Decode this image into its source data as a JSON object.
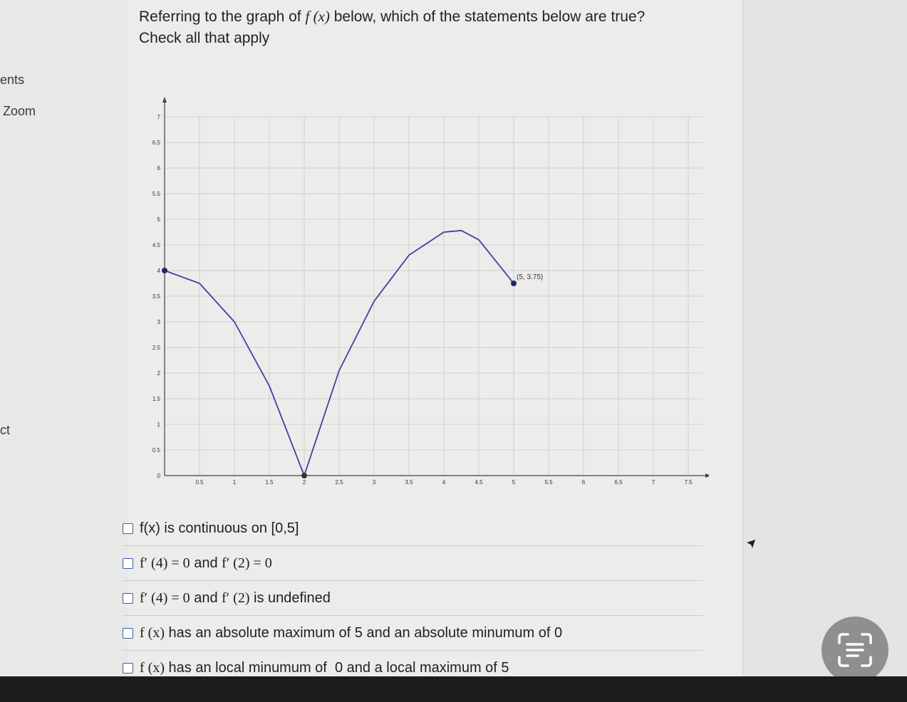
{
  "sidebar": {
    "items": [
      "ents",
      "Zoom",
      "ct"
    ]
  },
  "question": {
    "line1_a": "Referring to the graph of ",
    "fx": "f (x)",
    "line1_b": " below, which of the statements below are true?",
    "line2": "Check all that apply"
  },
  "chart_data": {
    "type": "line",
    "xlim": [
      0,
      7.5
    ],
    "ylim": [
      0,
      7
    ],
    "x_ticks": [
      "0.5",
      "1",
      "1.5",
      "2",
      "2.5",
      "3",
      "3.5",
      "4",
      "4.5",
      "5",
      "5.5",
      "6",
      "6.5",
      "7",
      "7.5"
    ],
    "y_ticks": [
      "0",
      "0.5",
      "1",
      "1.5",
      "2",
      "2.5",
      "3",
      "3.5",
      "4",
      "4.5",
      "5",
      "5.5",
      "6",
      "6.5",
      "7"
    ],
    "grid": true,
    "points": [
      [
        0,
        4
      ],
      [
        2,
        0
      ],
      [
        5,
        3.75
      ]
    ],
    "curve": [
      [
        0,
        4
      ],
      [
        0.5,
        3.75
      ],
      [
        1,
        3
      ],
      [
        1.5,
        1.75
      ],
      [
        2,
        0
      ],
      [
        2.5,
        2.05
      ],
      [
        3,
        3.4
      ],
      [
        3.5,
        4.3
      ],
      [
        4,
        4.75
      ],
      [
        4.25,
        4.78
      ],
      [
        4.5,
        4.6
      ],
      [
        5,
        3.75
      ]
    ],
    "annotation": "(5, 3.75)",
    "color": "#4040a8"
  },
  "options": [
    {
      "text": "f(x) is continuous on [0,5]"
    },
    {
      "parts": [
        "f′ (4) = 0",
        " and ",
        "f′ (2) = 0"
      ]
    },
    {
      "parts": [
        "f′ (4) = 0",
        " and ",
        "f′ (2)",
        " is undefined"
      ]
    },
    {
      "parts": [
        "f (x)",
        " has an absolute maximum of 5 and an absolute minumum of 0"
      ]
    },
    {
      "parts": [
        "f (x)",
        " has an local minumum of  0 and a local maximum of 5"
      ]
    }
  ]
}
